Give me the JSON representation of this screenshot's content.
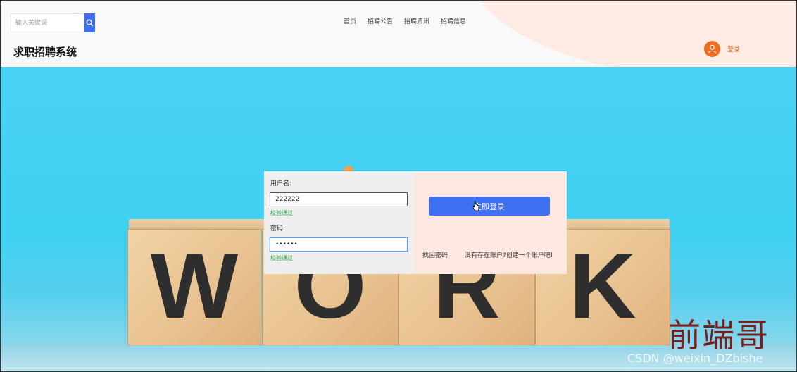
{
  "search": {
    "placeholder": "输入关键词"
  },
  "nav": {
    "items": [
      "首页",
      "招聘公告",
      "招聘资讯",
      "招聘信息"
    ]
  },
  "site": {
    "title": "求职招聘系统"
  },
  "header": {
    "login_label": "登录"
  },
  "hero": {
    "letters": [
      "W",
      "O",
      "R",
      "K"
    ]
  },
  "login_form": {
    "username_label": "用户名:",
    "username_value": "222222",
    "username_status": "校验通过",
    "password_label": "密码:",
    "password_value": "••••••",
    "password_status": "校验通过",
    "submit_label": "立即登录",
    "forgot_label": "找回密码",
    "register_label": "没有存在账户?创建一个账户吧!"
  },
  "watermark": {
    "cn": "前端哥",
    "csdn": "CSDN @weixin_DZbishe"
  },
  "colors": {
    "primary": "#3f6ff3",
    "accent": "#f06a1f",
    "success": "#22a03a",
    "panel_right": "#fde9e1"
  },
  "icons": {
    "search": "search-icon",
    "user": "user-icon"
  }
}
